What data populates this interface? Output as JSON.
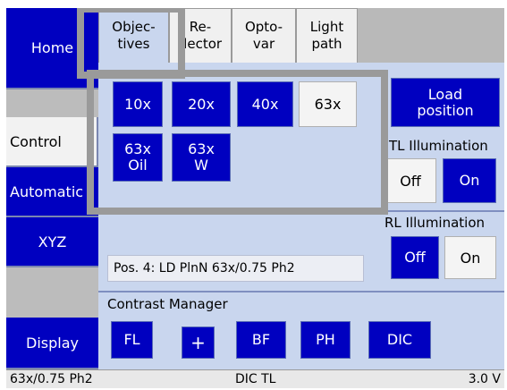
{
  "nav": {
    "home": "Home",
    "control": "Control",
    "automation": "Automatic",
    "xyz": "XYZ",
    "display": "Display"
  },
  "tabs": [
    {
      "line1": "Objec-",
      "line2": "tives"
    },
    {
      "line1": "Re-",
      "line2": "flector"
    },
    {
      "line1": "Opto-",
      "line2": "var"
    },
    {
      "line1": "Light",
      "line2": "path"
    }
  ],
  "objectives": {
    "b10x": "10x",
    "b20x": "20x",
    "b40x": "40x",
    "b63x": "63x",
    "b63xoil": {
      "line1": "63x",
      "line2": "Oil"
    },
    "b63xw": {
      "line1": "63x",
      "line2": "W"
    }
  },
  "load_position": {
    "line1": "Load",
    "line2": "position"
  },
  "tl_illumination": {
    "label": "TL Illumination",
    "off": "Off",
    "on": "On"
  },
  "rl_illumination": {
    "label": "RL Illumination",
    "off": "Off",
    "on": "On"
  },
  "position_text": "Pos. 4: LD PlnN 63x/0.75 Ph2",
  "contrast_manager": {
    "label": "Contrast Manager",
    "fl": "FL",
    "plus": "+",
    "bf": "BF",
    "ph": "PH",
    "dic": "DIC"
  },
  "status": {
    "objective": "63x/0.75 Ph2",
    "mode": "DIC TL",
    "version": "3.0 V"
  },
  "colors": {
    "button_blue": "#0000c0",
    "panel_bg": "#c9d6ee",
    "highlight_frame": "#9a9a9a"
  }
}
